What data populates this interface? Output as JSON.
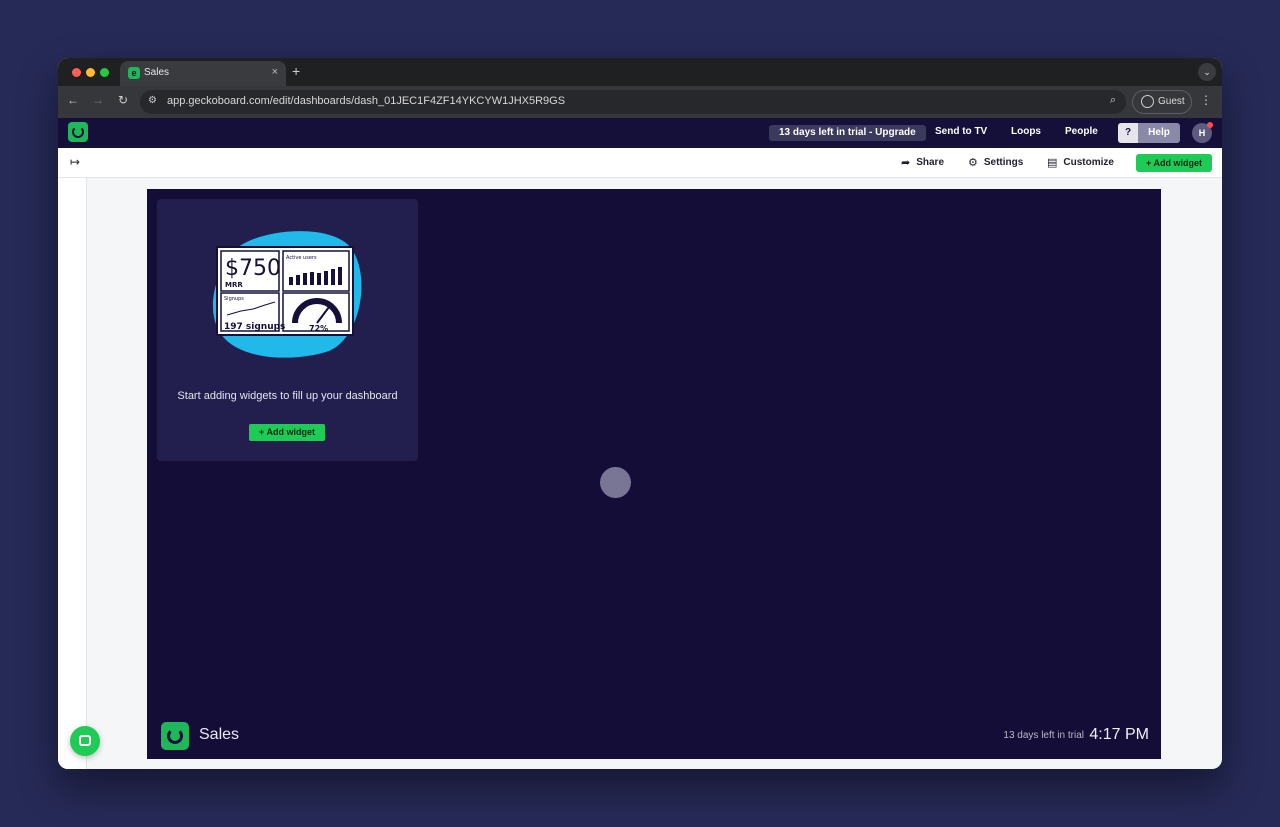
{
  "browser": {
    "tab_title": "Sales",
    "tab_close": "×",
    "new_tab": "+",
    "url": "app.geckoboard.com/edit/dashboards/dash_01JEC1F4ZF14YKCYW1JHX5R9GS",
    "profile_label": "Guest",
    "icons": [
      "back-arrow-icon",
      "forward-arrow-icon",
      "reload-icon",
      "site-settings-icon",
      "zoom-icon",
      "guest-profile-icon",
      "menu-icon"
    ]
  },
  "header": {
    "trial_button": "13 days left in trial - Upgrade",
    "send_to_tv": "Send to TV",
    "loops": "Loops",
    "people": "People",
    "help_q": "?",
    "help": "Help",
    "avatar_initial": "H"
  },
  "toolbar": {
    "share": "Share",
    "settings": "Settings",
    "customize": "Customize",
    "add_widget": "Add widget"
  },
  "empty_state": {
    "message": "Start adding widgets to fill up your dashboard",
    "add_widget": "Add widget",
    "illustration_text": {
      "mrr_value": "$750",
      "mrr_label": "MRR",
      "signups_title": "Signups",
      "signups_value": "197 signups",
      "gauge_value": "72%",
      "active_title": "Active users"
    }
  },
  "dashboard": {
    "title": "Sales",
    "trial_notice": "13 days left in trial",
    "clock": "4:17 PM"
  },
  "colors": {
    "accent_green": "#1ecb55",
    "header_bg": "#14103a",
    "dashboard_bg": "#130d37",
    "card_bg": "#221f4e"
  }
}
